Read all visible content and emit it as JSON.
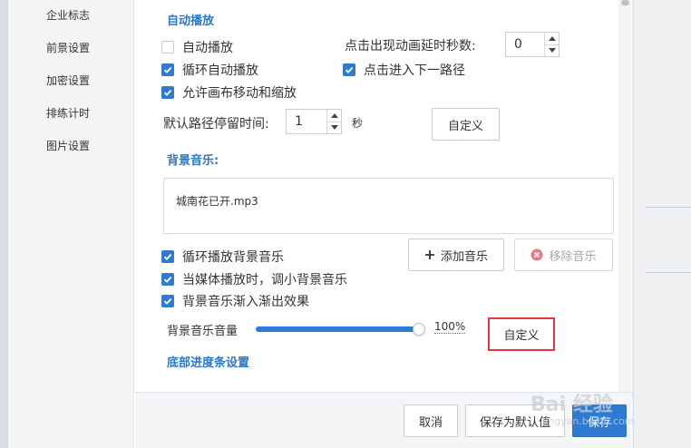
{
  "sidebar": {
    "items": [
      {
        "label": "企业标志"
      },
      {
        "label": "前景设置"
      },
      {
        "label": "加密设置"
      },
      {
        "label": "排练计时"
      },
      {
        "label": "图片设置"
      }
    ]
  },
  "autoplay": {
    "section_title": "自动播放",
    "auto_play": {
      "label": "自动播放",
      "checked": false
    },
    "loop_auto_play": {
      "label": "循环自动播放",
      "checked": true
    },
    "allow_canvas_move_zoom": {
      "label": "允许画布移动和缩放",
      "checked": true
    },
    "click_next_path": {
      "label": "点击进入下一路径",
      "checked": true
    },
    "delay_label": "点击出现动画延时秒数:",
    "delay_value": "0",
    "stay_time_label": "默认路径停留时间:",
    "stay_time_value": "1",
    "stay_time_unit": "秒",
    "custom_button": "自定义"
  },
  "bg_music": {
    "section_title": "背景音乐:",
    "files": [
      "城南花已开.mp3"
    ],
    "loop_music": {
      "label": "循环播放背景音乐",
      "checked": true
    },
    "lower_on_media": {
      "label": "当媒体播放时，调小背景音乐",
      "checked": true
    },
    "fade_in_out": {
      "label": "背景音乐渐入渐出效果",
      "checked": true
    },
    "add_button": "添加音乐",
    "remove_button": "移除音乐",
    "volume_label": "背景音乐音量",
    "volume_value": "100%",
    "volume_fraction": 1.0,
    "custom_button": "自定义"
  },
  "progress_section": {
    "section_title": "底部进度条设置"
  },
  "footer": {
    "cancel": "取消",
    "save_default": "保存为默认值",
    "save": "保存"
  },
  "watermark": {
    "text": "Bai 经验",
    "sub": "jingyan.baidu.com"
  },
  "colors": {
    "accent": "#2e7bd1",
    "section_title": "#2a78c8",
    "highlight_frame": "#e0393e"
  }
}
